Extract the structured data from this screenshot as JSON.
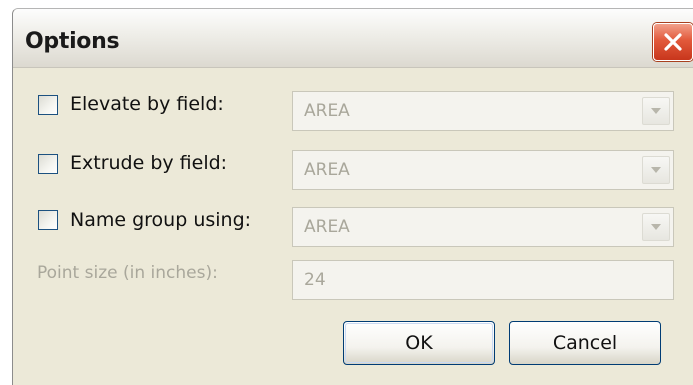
{
  "dialog": {
    "title": "Options"
  },
  "rows": [
    {
      "checkbox_label": "Elevate by field:",
      "checked": false,
      "select_value": "AREA"
    },
    {
      "checkbox_label": "Extrude by field:",
      "checked": false,
      "select_value": "AREA"
    },
    {
      "checkbox_label": "Name group using:",
      "checked": false,
      "select_value": "AREA"
    }
  ],
  "point_size": {
    "label": "Point size (in inches):",
    "value": "24"
  },
  "buttons": {
    "ok": "OK",
    "cancel": "Cancel"
  },
  "icons": {
    "close": "close-icon",
    "dropdown": "chevron-down-icon"
  },
  "colors": {
    "dialog_bg": "#ece9d8",
    "close_button": "#e2593b",
    "disabled_text": "#a9a79b",
    "button_border": "#003c74"
  }
}
